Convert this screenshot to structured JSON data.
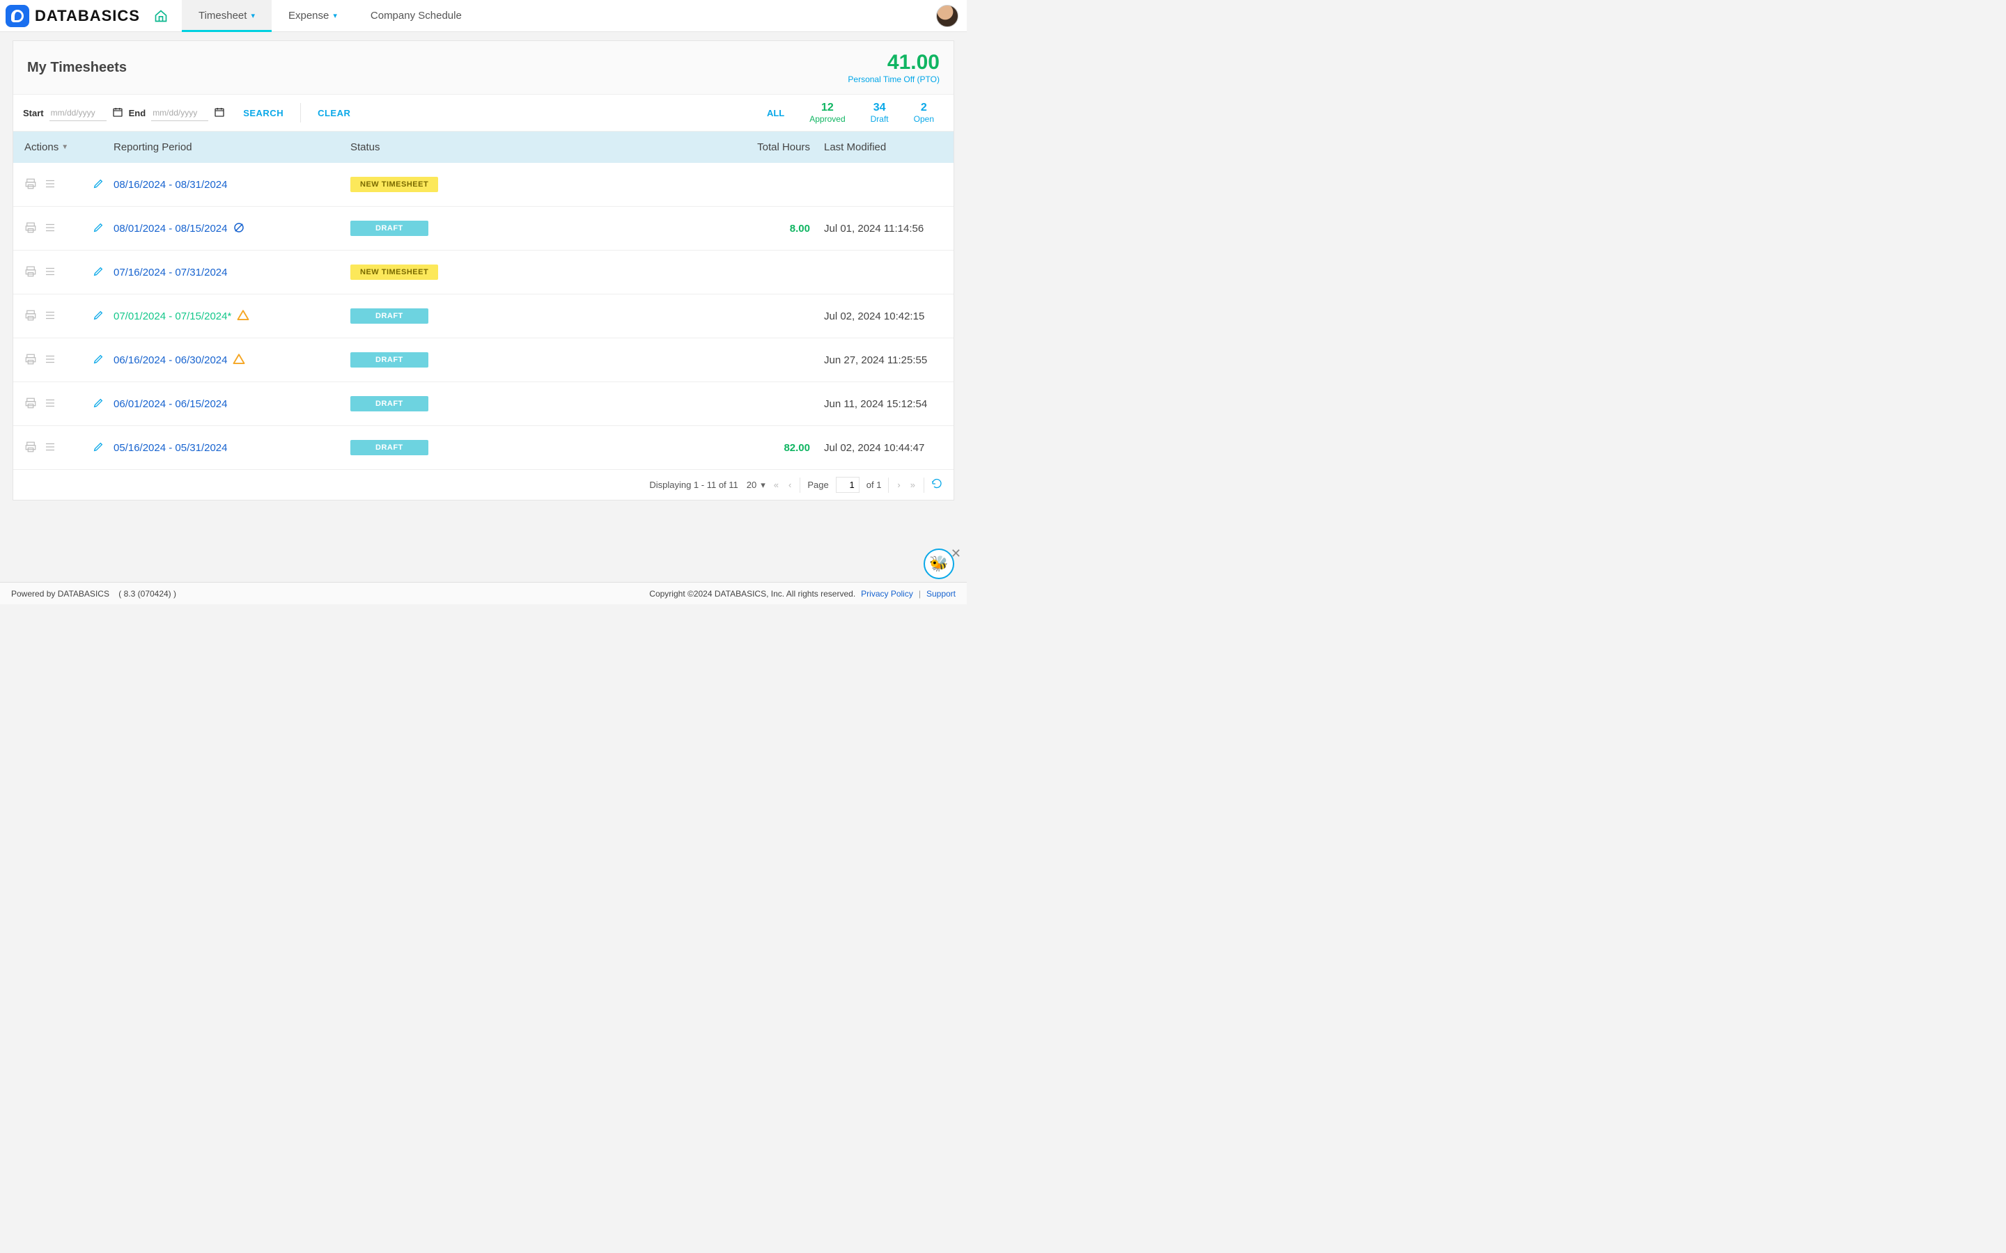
{
  "brand": "DATABASICS",
  "nav": {
    "timesheet": "Timesheet",
    "expense": "Expense",
    "schedule": "Company Schedule"
  },
  "page_title": "My Timesheets",
  "pto": {
    "value": "41.00",
    "label": "Personal Time Off (PTO)"
  },
  "filter": {
    "start_label": "Start",
    "end_label": "End",
    "placeholder": "mm/dd/yyyy",
    "search": "SEARCH",
    "clear": "CLEAR",
    "all": "ALL",
    "approved": {
      "num": "12",
      "label": "Approved"
    },
    "draft": {
      "num": "34",
      "label": "Draft"
    },
    "open": {
      "num": "2",
      "label": "Open"
    }
  },
  "columns": {
    "actions": "Actions",
    "period": "Reporting Period",
    "status": "Status",
    "hours": "Total Hours",
    "modified": "Last Modified"
  },
  "badges": {
    "new": "NEW TIMESHEET",
    "draft": "DRAFT"
  },
  "rows": [
    {
      "period": "08/16/2024 - 08/31/2024",
      "status": "new",
      "hours": "",
      "modified": "",
      "green": false,
      "indicator": ""
    },
    {
      "period": "08/01/2024 - 08/15/2024",
      "status": "draft",
      "hours": "8.00",
      "modified": "Jul 01, 2024 11:14:56",
      "green": false,
      "indicator": "hidden"
    },
    {
      "period": "07/16/2024 - 07/31/2024",
      "status": "new",
      "hours": "",
      "modified": "",
      "green": false,
      "indicator": ""
    },
    {
      "period": "07/01/2024 - 07/15/2024*",
      "status": "draft",
      "hours": "",
      "modified": "Jul 02, 2024 10:42:15",
      "green": true,
      "indicator": "warn"
    },
    {
      "period": "06/16/2024 - 06/30/2024",
      "status": "draft",
      "hours": "",
      "modified": "Jun 27, 2024 11:25:55",
      "green": false,
      "indicator": "warn"
    },
    {
      "period": "06/01/2024 - 06/15/2024",
      "status": "draft",
      "hours": "",
      "modified": "Jun 11, 2024 15:12:54",
      "green": false,
      "indicator": ""
    },
    {
      "period": "05/16/2024 - 05/31/2024",
      "status": "draft",
      "hours": "82.00",
      "modified": "Jul 02, 2024 10:44:47",
      "green": false,
      "indicator": ""
    }
  ],
  "paging": {
    "displaying": "Displaying 1 - 11 of 11",
    "page_size": "20",
    "page_label": "Page",
    "page_value": "1",
    "of": "of 1"
  },
  "footer": {
    "powered": "Powered by DATABASICS",
    "version": "( 8.3 (070424) )",
    "copyright": "Copyright ©2024 DATABASICS, Inc. All rights reserved.",
    "privacy": "Privacy Policy",
    "support": "Support"
  },
  "help_emoji": "🐝"
}
